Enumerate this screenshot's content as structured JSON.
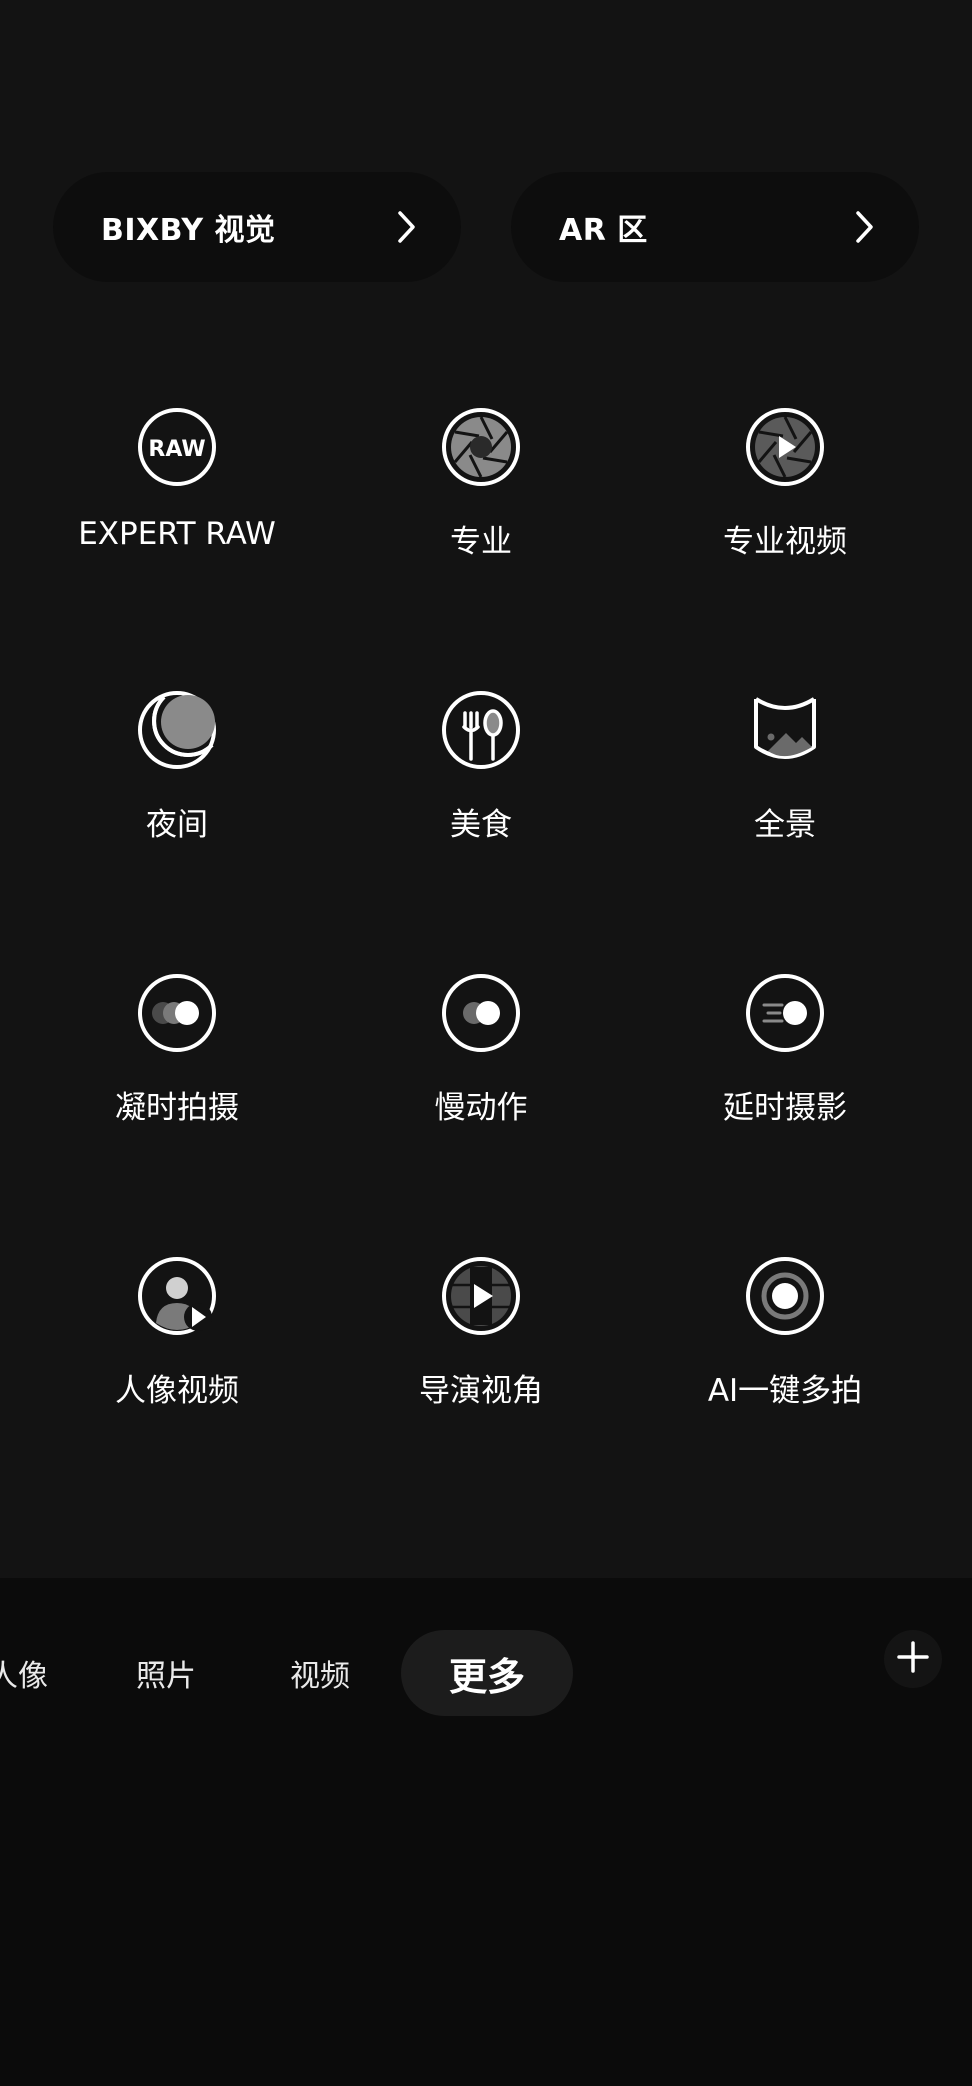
{
  "shortcuts": [
    {
      "label": "BIXBY 视觉",
      "icon": "chevron-right-icon"
    },
    {
      "label": "AR 区",
      "icon": "chevron-right-icon"
    }
  ],
  "modes": [
    {
      "label": "EXPERT RAW",
      "icon": "raw-icon",
      "icon_text": "RAW"
    },
    {
      "label": "专业",
      "icon": "aperture-icon"
    },
    {
      "label": "专业视频",
      "icon": "aperture-video-icon"
    },
    {
      "label": "夜间",
      "icon": "moon-icon"
    },
    {
      "label": "美食",
      "icon": "fork-spoon-icon"
    },
    {
      "label": "全景",
      "icon": "panorama-icon"
    },
    {
      "label": "凝时拍摄",
      "icon": "hyperlapse-icon"
    },
    {
      "label": "慢动作",
      "icon": "slow-motion-icon"
    },
    {
      "label": "延时摄影",
      "icon": "timelapse-icon"
    },
    {
      "label": "人像视频",
      "icon": "portrait-video-icon"
    },
    {
      "label": "导演视角",
      "icon": "director-view-icon"
    },
    {
      "label": "AI一键多拍",
      "icon": "single-take-icon"
    }
  ],
  "tabs": [
    {
      "label": "人像",
      "active": false
    },
    {
      "label": "照片",
      "active": false
    },
    {
      "label": "视频",
      "active": false
    },
    {
      "label": "更多",
      "active": true
    }
  ],
  "add_button_icon": "plus-icon"
}
